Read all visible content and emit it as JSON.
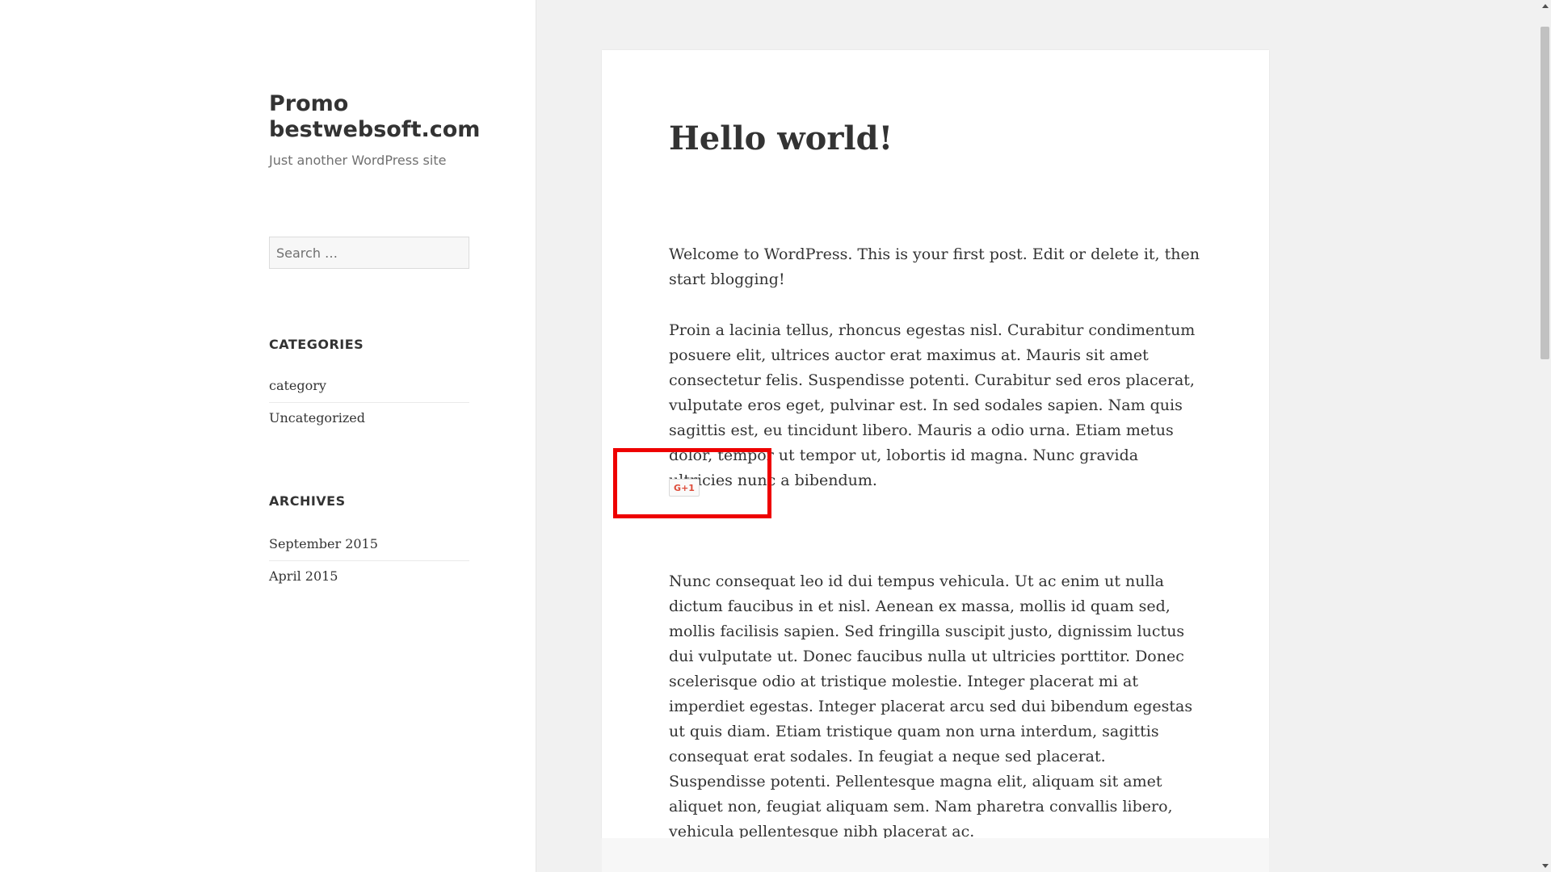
{
  "site": {
    "title": "Promo bestwebsoft.com",
    "tagline": "Just another WordPress site"
  },
  "search": {
    "placeholder": "Search …"
  },
  "widgets": {
    "categories": {
      "title": "CATEGORIES",
      "items": [
        "category",
        "Uncategorized"
      ]
    },
    "archives": {
      "title": "ARCHIVES",
      "items": [
        "September 2015",
        "April 2015"
      ]
    }
  },
  "post": {
    "title": "Hello world!",
    "paragraphs": [
      "Welcome to WordPress. This is your first post. Edit or delete it, then start blogging!",
      "Proin a lacinia tellus, rhoncus egestas nisl. Curabitur condimentum posuere elit, ultrices auctor erat maximus at. Mauris sit amet consectetur felis. Suspendisse potenti. Curabitur sed eros placerat, vulputate eros eget, pulvinar est. In sed sodales sapien. Nam quis sagittis est, eu tincidunt libero. Mauris a odio urna. Etiam metus dolor, tempor ut tempor ut, lobortis id magna. Nunc gravida ultricies nunc a bibendum.",
      "Nunc consequat leo id dui tempus vehicula. Ut ac enim ut nulla dictum faucibus in et nisl. Aenean ex massa, mollis id quam sed, mollis facilisis sapien. Sed fringilla suscipit justo, dignissim luctus dui vulputate ut. Donec faucibus nulla ut ultricies porttitor. Donec scelerisque odio at tristique molestie. Integer placerat mi at imperdiet egestas. Integer placerat arcu sed dui bibendum egestas ut quis diam. Etiam tristique quam non urna interdum, sagittis consequat erat sodales. In feugiat a neque sed placerat. Suspendisse potenti. Pellentesque magna elit, aliquam sit amet aliquet non, feugiat aliquam sem. Nam pharetra convallis libero, vehicula pellentesque nibh placerat ac."
    ],
    "gplus_label": "G+1"
  },
  "colors": {
    "highlight": "#ee0000",
    "gplus": "#dd4b39"
  }
}
